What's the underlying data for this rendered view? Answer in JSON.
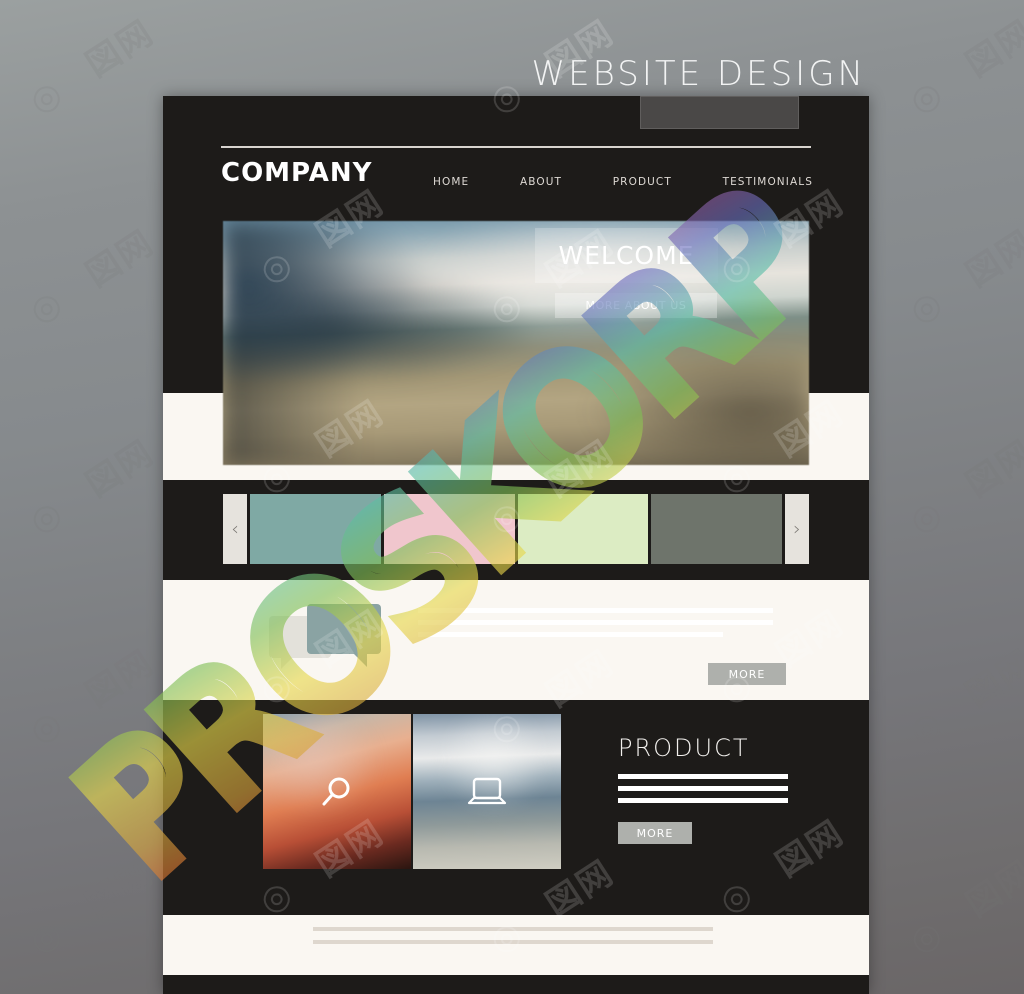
{
  "poster": {
    "title": "WEBSITE DESIGN",
    "watermark_text": "PROSKORP",
    "watermark_tile": "六图网",
    "background_colors": [
      "#9ba0a0",
      "#76767a",
      "#6a6667"
    ]
  },
  "site": {
    "background": "#1d1b19",
    "cream": "#faf7f2",
    "brand": "COMPANY",
    "nav": [
      {
        "label": "HOME"
      },
      {
        "label": "ABOUT"
      },
      {
        "label": "PRODUCT"
      },
      {
        "label": "TESTIMONIALS"
      }
    ],
    "hero": {
      "headline": "WELCOME",
      "cta_label": "MORE ABOUT US"
    },
    "carousel": {
      "prev_label": "‹",
      "next_label": "›",
      "slides": [
        {
          "name": "slide-teal",
          "color": "#7fa9a4"
        },
        {
          "name": "slide-pink",
          "color": "#f0c6cd"
        },
        {
          "name": "slide-green",
          "color": "#dcecc3"
        },
        {
          "name": "slide-gray",
          "color": "#6e746b"
        }
      ]
    },
    "testimonials": {
      "icon": "speech-bubbles-icon",
      "lines": 3,
      "more_label": "MORE"
    },
    "product": {
      "title": "PRODUCT",
      "lines": 3,
      "more_label": "MORE",
      "images": [
        {
          "name": "product-image-search",
          "icon": "magnifier-icon"
        },
        {
          "name": "product-image-laptop",
          "icon": "laptop-icon"
        }
      ]
    },
    "footer": {
      "lines": 2
    }
  }
}
